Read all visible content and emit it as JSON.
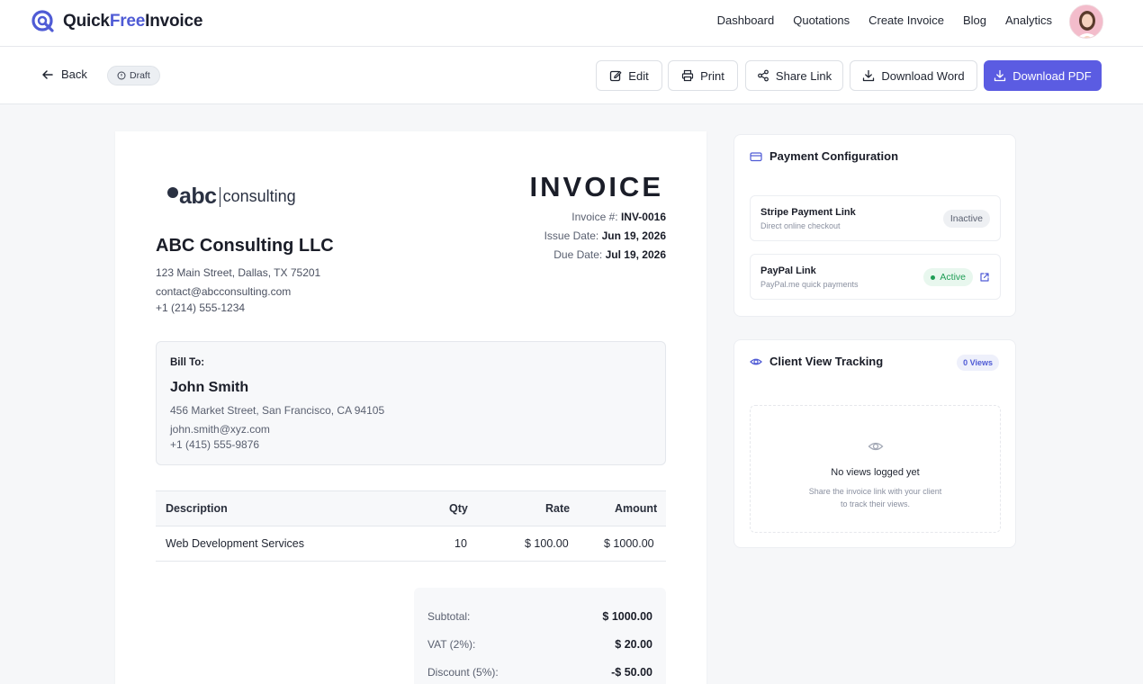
{
  "brand": {
    "name_part1": "Quick",
    "name_part2": "Free",
    "name_part3": "Invoice"
  },
  "nav": {
    "links": [
      "Dashboard",
      "Quotations",
      "Create Invoice",
      "Blog",
      "Analytics"
    ]
  },
  "toolbar": {
    "back_label": "Back",
    "status_label": "Draft",
    "edit_label": "Edit",
    "print_label": "Print",
    "share_label": "Share Link",
    "download_word_label": "Download Word",
    "download_pdf_label": "Download PDF"
  },
  "invoice": {
    "title": "INVOICE",
    "logo_main": "abc",
    "logo_sub": "consulting",
    "company_name": "ABC Consulting LLC",
    "company_address": "123 Main Street, Dallas, TX 75201",
    "company_email": "contact@abcconsulting.com",
    "company_phone": "+1 (214) 555-1234",
    "number_label": "Invoice #:",
    "number": "INV-0016",
    "issue_label": "Issue Date:",
    "issue_date": "Jun 19, 2026",
    "due_label": "Due Date:",
    "due_date": "Jul 19, 2026",
    "bill_to_label": "Bill To:",
    "client_name": "John Smith",
    "client_address": "456 Market Street, San Francisco, CA 94105",
    "client_email": "john.smith@xyz.com",
    "client_phone": "+1 (415) 555-9876",
    "columns": {
      "description": "Description",
      "qty": "Qty",
      "rate": "Rate",
      "amount": "Amount"
    },
    "items": [
      {
        "description": "Web Development Services",
        "qty": "10",
        "rate": "$ 100.00",
        "amount": "$ 1000.00"
      }
    ],
    "totals": {
      "subtotal_label": "Subtotal:",
      "subtotal": "$ 1000.00",
      "vat_label": "VAT (2%):",
      "vat": "$ 20.00",
      "discount_label": "Discount (5%):",
      "discount": "-$ 50.00"
    }
  },
  "payment": {
    "title": "Payment Configuration",
    "stripe_title": "Stripe Payment Link",
    "stripe_sub": "Direct online checkout",
    "stripe_status": "Inactive",
    "paypal_title": "PayPal Link",
    "paypal_sub": "PayPal.me quick payments",
    "paypal_status": "Active"
  },
  "tracking": {
    "title": "Client View Tracking",
    "views_badge": "0 Views",
    "empty_title": "No views logged yet",
    "empty_desc_1": "Share the invoice link with your client",
    "empty_desc_2": "to track their views."
  },
  "colors": {
    "accent": "#5b5ce2",
    "brand_accent": "#4f5bd5",
    "active_green": "#1f9d55",
    "active_bg": "#e8f7ee"
  }
}
